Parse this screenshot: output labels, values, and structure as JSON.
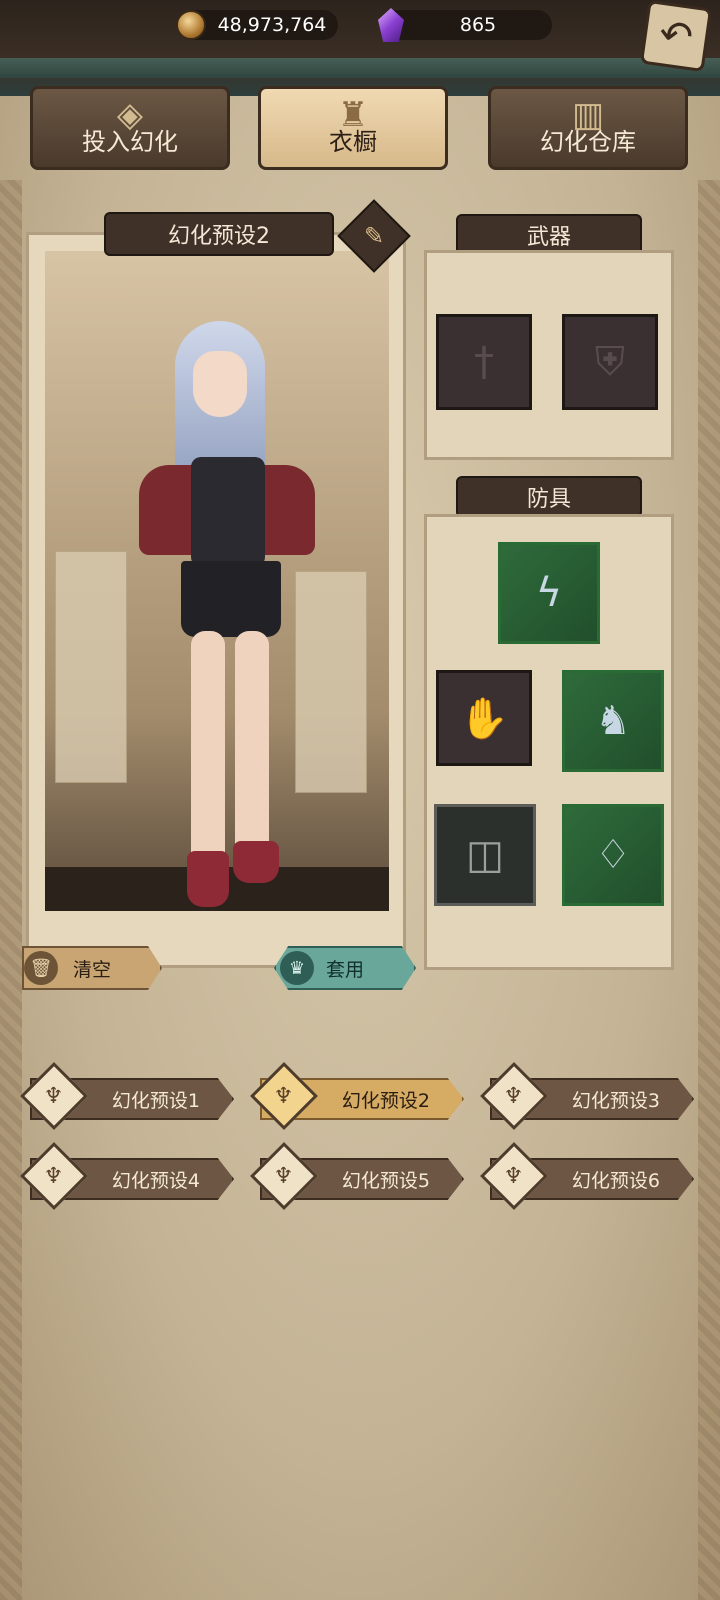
{
  "currency": {
    "gold": "48,973,764",
    "gems": "865",
    "gold_icon": "gold-coin-icon",
    "gem_icon": "purple-crystal-icon"
  },
  "tabs": [
    {
      "label": "投入幻化",
      "icon": "mask-icon",
      "active": false
    },
    {
      "label": "衣橱",
      "icon": "wardrobe-emblem-icon",
      "active": true
    },
    {
      "label": "幻化仓库",
      "icon": "cabinet-icon",
      "active": false
    }
  ],
  "preview": {
    "preset_name": "幻化预设2",
    "clear_label": "清空",
    "apply_label": "套用"
  },
  "equipment": {
    "weapon_title": "武器",
    "armor_title": "防具"
  },
  "presets": [
    {
      "label": "幻化预设1",
      "active": false
    },
    {
      "label": "幻化预设2",
      "active": true
    },
    {
      "label": "幻化预设3",
      "active": false
    },
    {
      "label": "幻化预设4",
      "active": false
    },
    {
      "label": "幻化预设5",
      "active": false
    },
    {
      "label": "幻化预设6",
      "active": false
    }
  ],
  "colors": {
    "panel_dark": "#3f3127",
    "active_gold": "#d6ab64",
    "apply_teal": "#6aa79b",
    "rare_green": "#2f6b3b"
  }
}
